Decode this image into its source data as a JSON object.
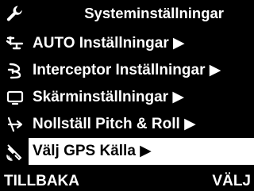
{
  "header": {
    "title": "Systeminställningar",
    "icon": "wrench-icon"
  },
  "menu": {
    "items": [
      {
        "label": "AUTO Inställningar ▶",
        "icon": "steering-icon",
        "selected": false
      },
      {
        "label": "Interceptor Inställningar ▶",
        "icon": "interceptor-icon",
        "selected": false
      },
      {
        "label": "Skärminställningar ▶",
        "icon": "monitor-icon",
        "selected": false
      },
      {
        "label": "Nollställ Pitch & Roll ▶",
        "icon": "reset-angle-icon",
        "selected": false
      },
      {
        "label": "Välj GPS Källa ▶",
        "icon": "satellite-icon",
        "selected": true
      }
    ]
  },
  "footer": {
    "back_label": "TILLBAKA",
    "select_label": "VÄLJ"
  },
  "colors": {
    "background": "#000000",
    "text": "#ffffff",
    "highlight": "#ffffff",
    "highlight_text": "#000000"
  }
}
